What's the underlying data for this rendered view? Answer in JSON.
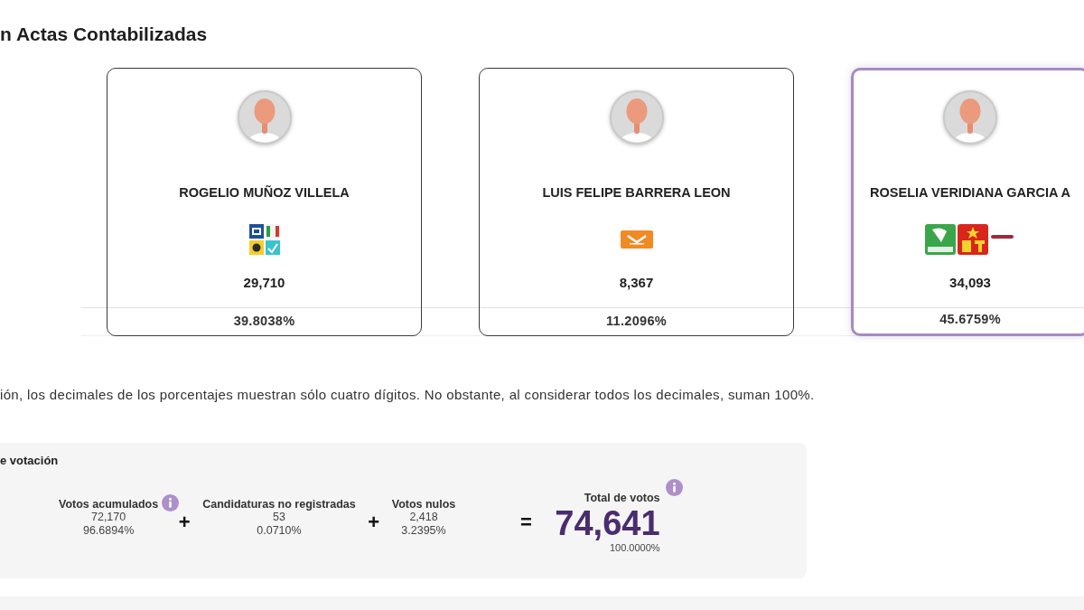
{
  "heading": {
    "title": "n Actas Contabilizadas"
  },
  "candidates": [
    {
      "name": "ROGELIO MUÑOZ VILLELA",
      "kind": "quad",
      "votes": "29,710",
      "percent": "39.8038%",
      "leading": false
    },
    {
      "name": "LUIS FELIPE BARRERA LEON",
      "kind": "single",
      "votes": "8,367",
      "percent": "11.2096%",
      "leading": false
    },
    {
      "name": "ROSELIA VERIDIANA GARCIA A",
      "kind": "triple",
      "votes": "34,093",
      "percent": "45.6759%",
      "leading": true
    }
  ],
  "note": "ión, los decimales de los porcentajes muestran sólo cuatro dígitos. No obstante, al considerar todos los decimales, suman 100%.",
  "summary": {
    "title": "e votación",
    "items": [
      {
        "kind": "term",
        "label": "Votos acumulados",
        "value": "72,170",
        "percent": "96.6894%",
        "info": true
      },
      {
        "kind": "operator",
        "symbol": "+"
      },
      {
        "kind": "term",
        "label": "Candidaturas no registradas",
        "value": "53",
        "percent": "0.0710%",
        "info": false
      },
      {
        "kind": "operator",
        "symbol": "+"
      },
      {
        "kind": "term",
        "label": "Votos nulos",
        "value": "2,418",
        "percent": "3.2395%",
        "info": false
      }
    ],
    "total": {
      "operator": "=",
      "label": "Total de votos",
      "value": "74,641",
      "percent": "100.0000%",
      "info": true
    }
  }
}
